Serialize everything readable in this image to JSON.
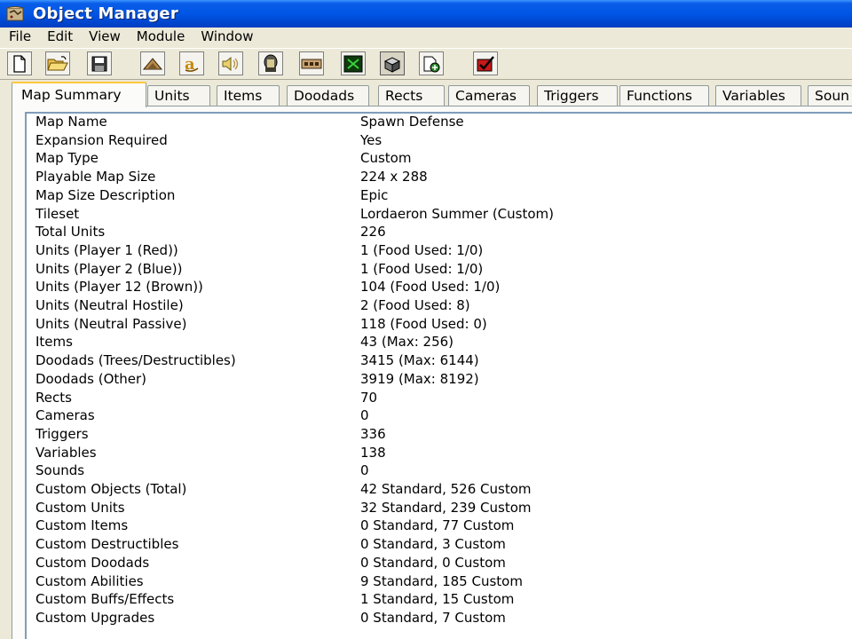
{
  "window": {
    "title": "Object Manager",
    "icon": "world-editor-icon"
  },
  "menu": [
    "File",
    "Edit",
    "View",
    "Module",
    "Window"
  ],
  "toolbar": [
    {
      "icon": "new-document-icon"
    },
    {
      "icon": "open-folder-icon"
    },
    {
      "icon": "save-disk-icon"
    },
    {
      "icon": "terrain-editor-icon"
    },
    {
      "icon": "trigger-editor-icon"
    },
    {
      "icon": "sound-editor-icon"
    },
    {
      "icon": "object-editor-icon"
    },
    {
      "icon": "campaign-editor-icon"
    },
    {
      "icon": "ai-editor-icon"
    },
    {
      "icon": "object-manager-icon"
    },
    {
      "icon": "import-manager-icon"
    },
    {
      "icon": "test-map-icon"
    }
  ],
  "tabs": [
    "Map Summary",
    "Units",
    "Items",
    "Doodads",
    "Rects",
    "Cameras",
    "Triggers",
    "Functions",
    "Variables",
    "Soun"
  ],
  "active_tab": "Map Summary",
  "summary": [
    {
      "label": "Map Name",
      "value": "Spawn Defense"
    },
    {
      "label": "Expansion Required",
      "value": "Yes"
    },
    {
      "label": "Map Type",
      "value": "Custom"
    },
    {
      "label": "Playable Map Size",
      "value": "224 x 288"
    },
    {
      "label": "Map Size Description",
      "value": "Epic"
    },
    {
      "label": "Tileset",
      "value": "Lordaeron Summer (Custom)"
    },
    {
      "label": "Total Units",
      "value": "226"
    },
    {
      "label": "Units (Player 1 (Red))",
      "value": "1 (Food Used: 1/0)"
    },
    {
      "label": "Units (Player 2 (Blue))",
      "value": "1 (Food Used: 1/0)"
    },
    {
      "label": "Units (Player 12 (Brown))",
      "value": "104 (Food Used: 1/0)"
    },
    {
      "label": "Units (Neutral Hostile)",
      "value": "2 (Food Used: 8)"
    },
    {
      "label": "Units (Neutral Passive)",
      "value": "118 (Food Used: 0)"
    },
    {
      "label": "Items",
      "value": "43 (Max: 256)"
    },
    {
      "label": "Doodads (Trees/Destructibles)",
      "value": "3415 (Max: 6144)"
    },
    {
      "label": "Doodads (Other)",
      "value": "3919 (Max: 8192)"
    },
    {
      "label": "Rects",
      "value": "70"
    },
    {
      "label": "Cameras",
      "value": "0"
    },
    {
      "label": "Triggers",
      "value": "336"
    },
    {
      "label": "Variables",
      "value": "138"
    },
    {
      "label": "Sounds",
      "value": "0"
    },
    {
      "label": "Custom Objects (Total)",
      "value": "42 Standard, 526 Custom"
    },
    {
      "label": "Custom Units",
      "value": "32 Standard, 239 Custom"
    },
    {
      "label": "Custom Items",
      "value": "0 Standard, 77 Custom"
    },
    {
      "label": "Custom Destructibles",
      "value": "0 Standard, 3 Custom"
    },
    {
      "label": "Custom Doodads",
      "value": "0 Standard, 0 Custom"
    },
    {
      "label": "Custom Abilities",
      "value": "9 Standard, 185 Custom"
    },
    {
      "label": "Custom Buffs/Effects",
      "value": "1 Standard, 15 Custom"
    },
    {
      "label": "Custom Upgrades",
      "value": "0 Standard, 7 Custom"
    }
  ]
}
